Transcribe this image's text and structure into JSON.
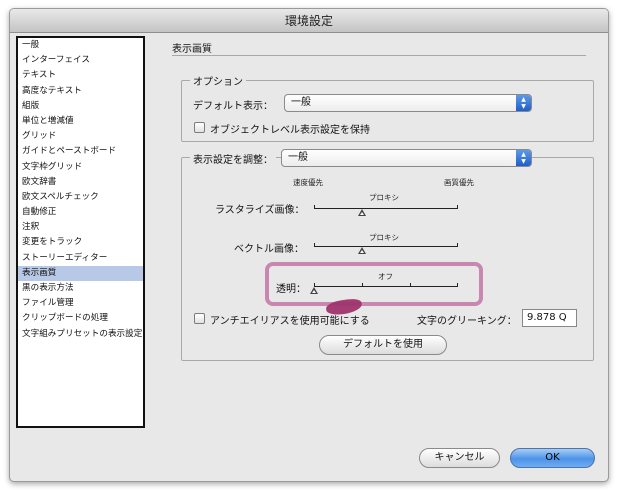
{
  "window": {
    "title": "環境設定"
  },
  "sidebar": {
    "items": [
      {
        "label": "一般"
      },
      {
        "label": "インターフェイス"
      },
      {
        "label": "テキスト"
      },
      {
        "label": "高度なテキスト"
      },
      {
        "label": "組版"
      },
      {
        "label": "単位と増減値"
      },
      {
        "label": "グリッド"
      },
      {
        "label": "ガイドとペーストボード"
      },
      {
        "label": "文字枠グリッド"
      },
      {
        "label": "欧文辞書"
      },
      {
        "label": "欧文スペルチェック"
      },
      {
        "label": "自動修正"
      },
      {
        "label": "注釈"
      },
      {
        "label": "変更をトラック"
      },
      {
        "label": "ストーリーエディター"
      },
      {
        "label": "表示画質"
      },
      {
        "label": "黒の表示方法"
      },
      {
        "label": "ファイル管理"
      },
      {
        "label": "クリップボードの処理"
      },
      {
        "label": "文字組みプリセットの表示設定"
      }
    ],
    "selected_label": "表示画質",
    "selected_color": "#b7c9e6"
  },
  "main": {
    "section_title": "表示画質",
    "options": {
      "legend": "オプション",
      "default_view_label": "デフォルト表示：",
      "default_view_value": "一般",
      "object_level_label": "オブジェクトレベル表示設定を保持",
      "object_level_checked": false
    },
    "adjust": {
      "legend_label": "表示設定を調整：",
      "legend_value": "一般",
      "speed_label": "速度優先",
      "quality_label": "画質優先",
      "raster": {
        "label": "ラスタライズ画像：",
        "value_label": "プロキシ",
        "level": 0.33
      },
      "vector": {
        "label": "ベクトル画像：",
        "value_label": "プロキシ",
        "level": 0.33
      },
      "transparency": {
        "label": "透明：",
        "value_label": "オフ",
        "level": 0.0
      },
      "antialias_label": "アンチエイリアスを使用可能にする",
      "antialias_checked": false,
      "greeking_label": "文字のグリーキング：",
      "greeking_value": "9.878 Q",
      "default_button": "デフォルトを使用"
    }
  },
  "footer": {
    "cancel_button": "キャンセル",
    "ok_button": "OK"
  },
  "colors": {
    "highlight": "#c986b1",
    "accent": "#4c93e8",
    "cursor": "#a0346e"
  }
}
